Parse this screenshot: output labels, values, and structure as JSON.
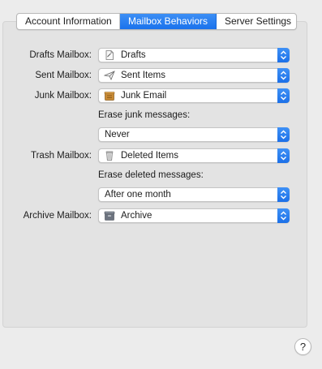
{
  "tabs": [
    {
      "label": "Account Information",
      "active": false
    },
    {
      "label": "Mailbox Behaviors",
      "active": true
    },
    {
      "label": "Server Settings",
      "active": false
    }
  ],
  "accent_color": "#1a72ec",
  "rows": {
    "drafts": {
      "label": "Drafts Mailbox:",
      "value": "Drafts",
      "icon": "document-icon"
    },
    "sent": {
      "label": "Sent Mailbox:",
      "value": "Sent Items",
      "icon": "paper-plane-icon"
    },
    "junk": {
      "label": "Junk Mailbox:",
      "value": "Junk Email",
      "icon": "junk-bin-icon"
    },
    "erase_junk": {
      "label": "Erase junk messages:",
      "value": "Never"
    },
    "trash": {
      "label": "Trash Mailbox:",
      "value": "Deleted Items",
      "icon": "trash-can-icon"
    },
    "erase_deleted": {
      "label": "Erase deleted messages:",
      "value": "After one month"
    },
    "archive": {
      "label": "Archive Mailbox:",
      "value": "Archive",
      "icon": "archive-box-icon"
    }
  },
  "help": {
    "label": "?"
  }
}
